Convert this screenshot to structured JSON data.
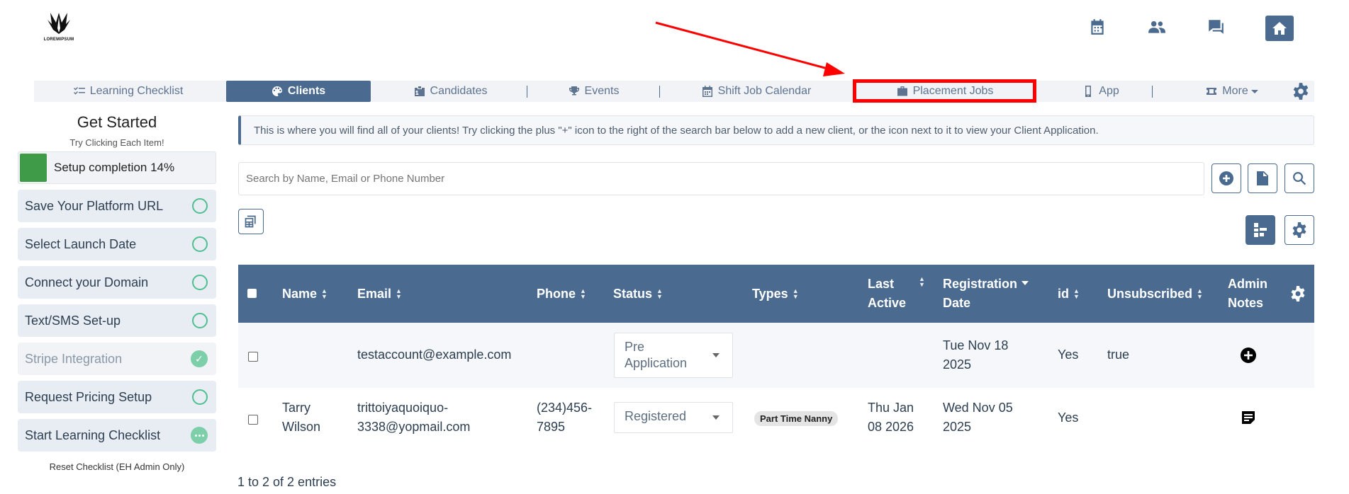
{
  "header": {
    "logo_text": "LOREMIPSUM",
    "icons": [
      "calendar-icon",
      "users-icon",
      "chat-icon",
      "home-icon"
    ]
  },
  "nav": {
    "items": [
      {
        "label": "Learning Checklist",
        "icon": "checklist-icon"
      },
      {
        "label": "Clients",
        "icon": "palette-icon",
        "active": true
      },
      {
        "label": "Candidates",
        "icon": "id-badge-icon"
      },
      {
        "label": "Events",
        "icon": "trophy-icon"
      },
      {
        "label": "Shift Job Calendar",
        "icon": "calendar-icon"
      },
      {
        "label": "Placement Jobs",
        "icon": "briefcase-icon",
        "highlighted": true
      },
      {
        "label": "App",
        "icon": "mobile-icon"
      },
      {
        "label": "More",
        "icon": "ticket-icon"
      }
    ],
    "highlight_color": "#ff0000"
  },
  "sidebar": {
    "title": "Get Started",
    "subtitle": "Try Clicking Each Item!",
    "progress_label": "Setup completion 14%",
    "progress_fraction": 0.14,
    "items": [
      {
        "label": "Save Your Platform URL",
        "state": "pending"
      },
      {
        "label": "Select Launch Date",
        "state": "pending"
      },
      {
        "label": "Connect your Domain",
        "state": "pending"
      },
      {
        "label": "Text/SMS Set-up",
        "state": "pending"
      },
      {
        "label": "Stripe Integration",
        "state": "done"
      },
      {
        "label": "Request Pricing Setup",
        "state": "pending"
      },
      {
        "label": "Start Learning Checklist",
        "state": "in-progress"
      }
    ],
    "reset_label": "Reset Checklist (EH Admin Only)"
  },
  "main": {
    "info_text": "This is where you will find all of your clients! Try clicking the plus \"+\" icon to the right of the search bar below to add a new client, or the icon next to it to view your Client Application.",
    "search_placeholder": "Search by Name, Email or Phone Number",
    "table": {
      "columns": [
        {
          "line1": "Name",
          "line2": ""
        },
        {
          "line1": "Email",
          "line2": ""
        },
        {
          "line1": "Phone",
          "line2": ""
        },
        {
          "line1": "Status",
          "line2": ""
        },
        {
          "line1": "Types",
          "line2": ""
        },
        {
          "line1": "Last",
          "line2": "Active"
        },
        {
          "line1": "Registration",
          "line2": "Date"
        },
        {
          "line1": "id",
          "line2": ""
        },
        {
          "line1": "Unsubscribed",
          "line2": ""
        },
        {
          "line1": "Admin",
          "line2": "Notes"
        }
      ],
      "rows": [
        {
          "name_line1": "",
          "name_line2": "",
          "email_line1": "testaccount@example.com",
          "email_line2": "",
          "phone_line1": "",
          "phone_line2": "",
          "status_line1": "Pre",
          "status_line2": "Application",
          "type": "",
          "last_active_line1": "",
          "last_active_line2": "",
          "registration_line1": "Tue Nov 18",
          "registration_line2": "2025",
          "id": "Yes",
          "unsubscribed": "true",
          "notes_icon": "plus-circle-icon"
        },
        {
          "name_line1": "Tarry",
          "name_line2": "Wilson",
          "email_line1": "trittoiyaquoiquo-",
          "email_line2": "3338@yopmail.com",
          "phone_line1": "(234)456-",
          "phone_line2": "7895",
          "status_line1": "Registered",
          "status_line2": "",
          "type": "Part Time Nanny",
          "last_active_line1": "Thu Jan",
          "last_active_line2": "08 2026",
          "registration_line1": "Wed Nov 05",
          "registration_line2": "2025",
          "id": "Yes",
          "unsubscribed": "",
          "notes_icon": "note-icon"
        }
      ]
    },
    "footer": "1 to 2 of 2 entries"
  },
  "colors": {
    "primary": "#4a6a8f",
    "progress": "#3f9b48",
    "check_ring": "#4fbf8f",
    "annotation": "#ff0000"
  }
}
